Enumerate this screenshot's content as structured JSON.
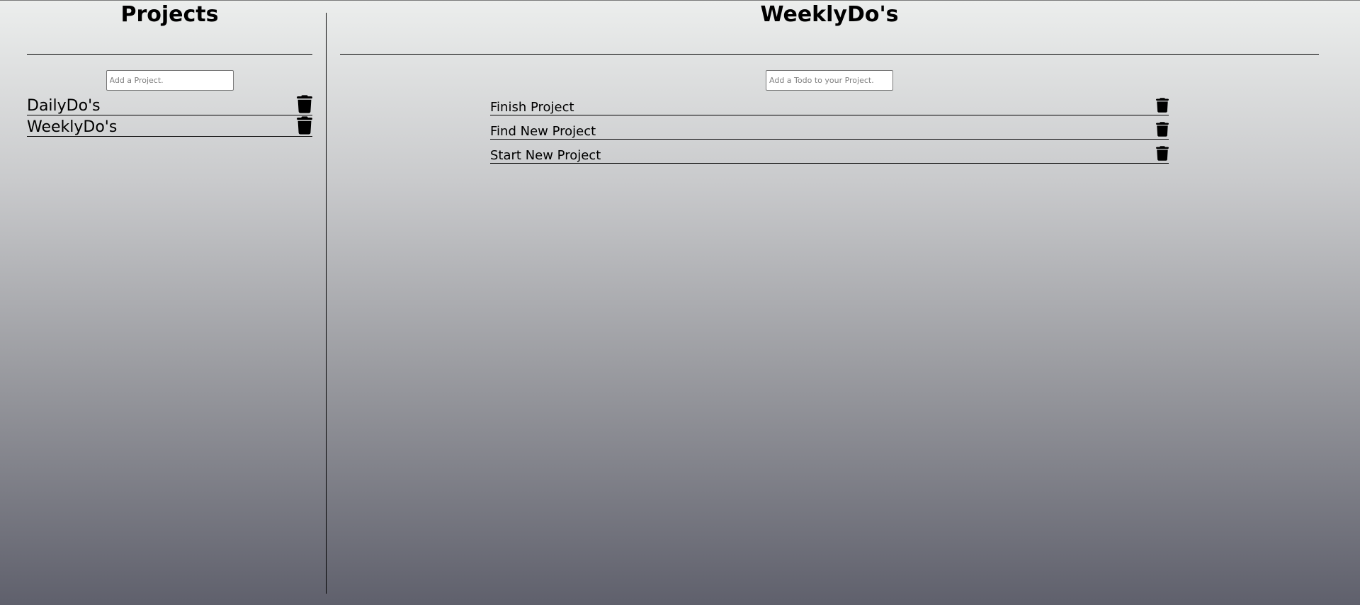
{
  "sidebar": {
    "title": "Projects",
    "input_placeholder": "Add a Project.",
    "projects": [
      {
        "label": "DailyDo's"
      },
      {
        "label": "WeeklyDo's"
      }
    ]
  },
  "main": {
    "title": "WeeklyDo's",
    "input_placeholder": "Add a Todo to your Project.",
    "todos": [
      {
        "label": "Finish Project"
      },
      {
        "label": "Find New Project"
      },
      {
        "label": "Start New Project"
      }
    ]
  },
  "icons": {
    "delete": "trash-icon"
  }
}
